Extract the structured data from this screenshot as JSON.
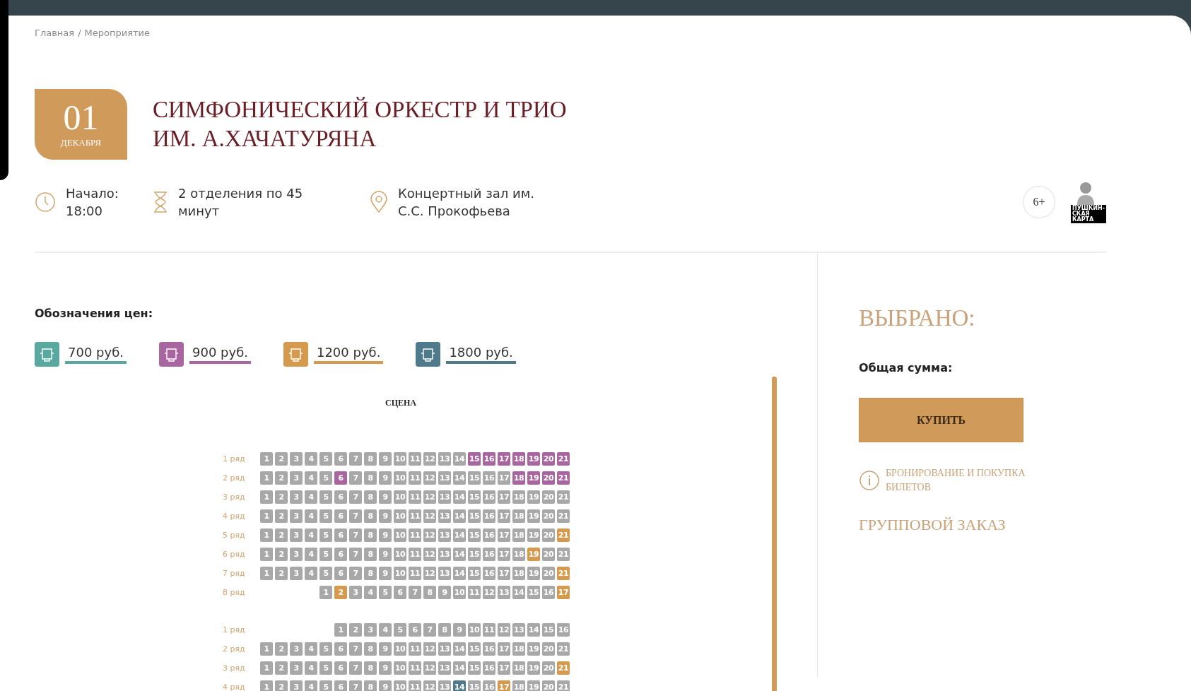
{
  "breadcrumb": [
    "Главная",
    "Мероприятие"
  ],
  "breadcrumb_separator": "/",
  "event": {
    "day": "01",
    "month": "ДЕКАБРЯ",
    "title": [
      "СИМФОНИЧЕСКИЙ ОРКЕСТР И ТРИО",
      "ИМ. А.ХАЧАТУРЯНА"
    ]
  },
  "info": [
    {
      "kind": "clock",
      "lines": [
        "Начало:",
        "18:00"
      ]
    },
    {
      "kind": "hourglass",
      "lines": [
        "2 отделения по 45",
        "минут"
      ]
    },
    {
      "kind": "pin",
      "lines": [
        "Концертный зал им.",
        "С.С. Прокофьева"
      ]
    }
  ],
  "age": "6+",
  "card_logo": [
    "ПУШКИН-",
    "СКАЯ",
    "КАРТА"
  ],
  "legend": {
    "title": "Обозначения цен:",
    "items": [
      {
        "label": "700 руб.",
        "color": "#5aa9a0"
      },
      {
        "label": "900 руб.",
        "color": "#a9659f"
      },
      {
        "label": "1200 руб.",
        "color": "#d59a4e"
      },
      {
        "label": "1800 руб.",
        "color": "#4f7a8c"
      }
    ]
  },
  "stage": "СЦЕНА",
  "sections": [
    {
      "rows": [
        {
          "label": "1 ряд",
          "seats": [
            {
              "n": "1",
              "color": "#a8a8a8"
            },
            {
              "n": "2",
              "color": "#a8a8a8"
            },
            {
              "n": "3",
              "color": "#a8a8a8"
            },
            {
              "n": "4",
              "color": "#a8a8a8"
            },
            {
              "n": "5",
              "color": "#a8a8a8"
            },
            {
              "n": "6",
              "color": "#a8a8a8"
            },
            {
              "n": "7",
              "color": "#a8a8a8"
            },
            {
              "n": "8",
              "color": "#a8a8a8"
            },
            {
              "n": "9",
              "color": "#a8a8a8"
            },
            {
              "n": "10",
              "color": "#a8a8a8"
            },
            {
              "n": "11",
              "color": "#a8a8a8"
            },
            {
              "n": "12",
              "color": "#a8a8a8"
            },
            {
              "n": "13",
              "color": "#a8a8a8"
            },
            {
              "n": "14",
              "color": "#a8a8a8"
            },
            {
              "n": "15",
              "color": "#a9659f"
            },
            {
              "n": "16",
              "color": "#a9659f"
            },
            {
              "n": "17",
              "color": "#a9659f"
            },
            {
              "n": "18",
              "color": "#a9659f"
            },
            {
              "n": "19",
              "color": "#a9659f"
            },
            {
              "n": "20",
              "color": "#a9659f"
            },
            {
              "n": "21",
              "color": "#a9659f"
            }
          ]
        },
        {
          "label": "2 ряд",
          "seats": [
            {
              "n": "1",
              "color": "#a8a8a8"
            },
            {
              "n": "2",
              "color": "#a8a8a8"
            },
            {
              "n": "3",
              "color": "#a8a8a8"
            },
            {
              "n": "4",
              "color": "#a8a8a8"
            },
            {
              "n": "5",
              "color": "#a8a8a8"
            },
            {
              "n": "6",
              "color": "#a9659f"
            },
            {
              "n": "7",
              "color": "#a8a8a8"
            },
            {
              "n": "8",
              "color": "#a8a8a8"
            },
            {
              "n": "9",
              "color": "#a8a8a8"
            },
            {
              "n": "10",
              "color": "#a8a8a8"
            },
            {
              "n": "11",
              "color": "#a8a8a8"
            },
            {
              "n": "12",
              "color": "#a8a8a8"
            },
            {
              "n": "13",
              "color": "#a8a8a8"
            },
            {
              "n": "14",
              "color": "#a8a8a8"
            },
            {
              "n": "15",
              "color": "#a8a8a8"
            },
            {
              "n": "16",
              "color": "#a8a8a8"
            },
            {
              "n": "17",
              "color": "#a8a8a8"
            },
            {
              "n": "18",
              "color": "#a9659f"
            },
            {
              "n": "19",
              "color": "#a9659f"
            },
            {
              "n": "20",
              "color": "#a9659f"
            },
            {
              "n": "21",
              "color": "#a9659f"
            }
          ]
        },
        {
          "label": "3 ряд",
          "seats": [
            {
              "n": "1",
              "color": "#a8a8a8"
            },
            {
              "n": "2",
              "color": "#a8a8a8"
            },
            {
              "n": "3",
              "color": "#a8a8a8"
            },
            {
              "n": "4",
              "color": "#a8a8a8"
            },
            {
              "n": "5",
              "color": "#a8a8a8"
            },
            {
              "n": "6",
              "color": "#a8a8a8"
            },
            {
              "n": "7",
              "color": "#a8a8a8"
            },
            {
              "n": "8",
              "color": "#a8a8a8"
            },
            {
              "n": "9",
              "color": "#a8a8a8"
            },
            {
              "n": "10",
              "color": "#a8a8a8"
            },
            {
              "n": "11",
              "color": "#a8a8a8"
            },
            {
              "n": "12",
              "color": "#a8a8a8"
            },
            {
              "n": "13",
              "color": "#a8a8a8"
            },
            {
              "n": "14",
              "color": "#a8a8a8"
            },
            {
              "n": "15",
              "color": "#a8a8a8"
            },
            {
              "n": "16",
              "color": "#a8a8a8"
            },
            {
              "n": "17",
              "color": "#a8a8a8"
            },
            {
              "n": "18",
              "color": "#a8a8a8"
            },
            {
              "n": "19",
              "color": "#a8a8a8"
            },
            {
              "n": "20",
              "color": "#a8a8a8"
            },
            {
              "n": "21",
              "color": "#a8a8a8"
            }
          ]
        },
        {
          "label": "4 ряд",
          "seats": [
            {
              "n": "1",
              "color": "#a8a8a8"
            },
            {
              "n": "2",
              "color": "#a8a8a8"
            },
            {
              "n": "3",
              "color": "#a8a8a8"
            },
            {
              "n": "4",
              "color": "#a8a8a8"
            },
            {
              "n": "5",
              "color": "#a8a8a8"
            },
            {
              "n": "6",
              "color": "#a8a8a8"
            },
            {
              "n": "7",
              "color": "#a8a8a8"
            },
            {
              "n": "8",
              "color": "#a8a8a8"
            },
            {
              "n": "9",
              "color": "#a8a8a8"
            },
            {
              "n": "10",
              "color": "#a8a8a8"
            },
            {
              "n": "11",
              "color": "#a8a8a8"
            },
            {
              "n": "12",
              "color": "#a8a8a8"
            },
            {
              "n": "13",
              "color": "#a8a8a8"
            },
            {
              "n": "14",
              "color": "#a8a8a8"
            },
            {
              "n": "15",
              "color": "#a8a8a8"
            },
            {
              "n": "16",
              "color": "#a8a8a8"
            },
            {
              "n": "17",
              "color": "#a8a8a8"
            },
            {
              "n": "18",
              "color": "#a8a8a8"
            },
            {
              "n": "19",
              "color": "#a8a8a8"
            },
            {
              "n": "20",
              "color": "#a8a8a8"
            },
            {
              "n": "21",
              "color": "#a8a8a8"
            }
          ]
        },
        {
          "label": "5 ряд",
          "seats": [
            {
              "n": "1",
              "color": "#a8a8a8"
            },
            {
              "n": "2",
              "color": "#a8a8a8"
            },
            {
              "n": "3",
              "color": "#a8a8a8"
            },
            {
              "n": "4",
              "color": "#a8a8a8"
            },
            {
              "n": "5",
              "color": "#a8a8a8"
            },
            {
              "n": "6",
              "color": "#a8a8a8"
            },
            {
              "n": "7",
              "color": "#a8a8a8"
            },
            {
              "n": "8",
              "color": "#a8a8a8"
            },
            {
              "n": "9",
              "color": "#a8a8a8"
            },
            {
              "n": "10",
              "color": "#a8a8a8"
            },
            {
              "n": "11",
              "color": "#a8a8a8"
            },
            {
              "n": "12",
              "color": "#a8a8a8"
            },
            {
              "n": "13",
              "color": "#a8a8a8"
            },
            {
              "n": "14",
              "color": "#a8a8a8"
            },
            {
              "n": "15",
              "color": "#a8a8a8"
            },
            {
              "n": "16",
              "color": "#a8a8a8"
            },
            {
              "n": "17",
              "color": "#a8a8a8"
            },
            {
              "n": "18",
              "color": "#a8a8a8"
            },
            {
              "n": "19",
              "color": "#a8a8a8"
            },
            {
              "n": "20",
              "color": "#a8a8a8"
            },
            {
              "n": "21",
              "color": "#d59a4e"
            }
          ]
        },
        {
          "label": "6 ряд",
          "seats": [
            {
              "n": "1",
              "color": "#a8a8a8"
            },
            {
              "n": "2",
              "color": "#a8a8a8"
            },
            {
              "n": "3",
              "color": "#a8a8a8"
            },
            {
              "n": "4",
              "color": "#a8a8a8"
            },
            {
              "n": "5",
              "color": "#a8a8a8"
            },
            {
              "n": "6",
              "color": "#a8a8a8"
            },
            {
              "n": "7",
              "color": "#a8a8a8"
            },
            {
              "n": "8",
              "color": "#a8a8a8"
            },
            {
              "n": "9",
              "color": "#a8a8a8"
            },
            {
              "n": "10",
              "color": "#a8a8a8"
            },
            {
              "n": "11",
              "color": "#a8a8a8"
            },
            {
              "n": "12",
              "color": "#a8a8a8"
            },
            {
              "n": "13",
              "color": "#a8a8a8"
            },
            {
              "n": "14",
              "color": "#a8a8a8"
            },
            {
              "n": "15",
              "color": "#a8a8a8"
            },
            {
              "n": "16",
              "color": "#a8a8a8"
            },
            {
              "n": "17",
              "color": "#a8a8a8"
            },
            {
              "n": "18",
              "color": "#a8a8a8"
            },
            {
              "n": "19",
              "color": "#d59a4e"
            },
            {
              "n": "20",
              "color": "#a8a8a8"
            },
            {
              "n": "21",
              "color": "#a8a8a8"
            }
          ]
        },
        {
          "label": "7 ряд",
          "seats": [
            {
              "n": "1",
              "color": "#a8a8a8"
            },
            {
              "n": "2",
              "color": "#a8a8a8"
            },
            {
              "n": "3",
              "color": "#a8a8a8"
            },
            {
              "n": "4",
              "color": "#a8a8a8"
            },
            {
              "n": "5",
              "color": "#a8a8a8"
            },
            {
              "n": "6",
              "color": "#a8a8a8"
            },
            {
              "n": "7",
              "color": "#a8a8a8"
            },
            {
              "n": "8",
              "color": "#a8a8a8"
            },
            {
              "n": "9",
              "color": "#a8a8a8"
            },
            {
              "n": "10",
              "color": "#a8a8a8"
            },
            {
              "n": "11",
              "color": "#a8a8a8"
            },
            {
              "n": "12",
              "color": "#a8a8a8"
            },
            {
              "n": "13",
              "color": "#a8a8a8"
            },
            {
              "n": "14",
              "color": "#a8a8a8"
            },
            {
              "n": "15",
              "color": "#a8a8a8"
            },
            {
              "n": "16",
              "color": "#a8a8a8"
            },
            {
              "n": "17",
              "color": "#a8a8a8"
            },
            {
              "n": "18",
              "color": "#a8a8a8"
            },
            {
              "n": "19",
              "color": "#a8a8a8"
            },
            {
              "n": "20",
              "color": "#a8a8a8"
            },
            {
              "n": "21",
              "color": "#d59a4e"
            }
          ]
        },
        {
          "label": "8 ряд",
          "seats": [
            {
              "n": "1",
              "color": "#a8a8a8"
            },
            {
              "n": "2",
              "color": "#d59a4e"
            },
            {
              "n": "3",
              "color": "#a8a8a8"
            },
            {
              "n": "4",
              "color": "#a8a8a8"
            },
            {
              "n": "5",
              "color": "#a8a8a8"
            },
            {
              "n": "6",
              "color": "#a8a8a8"
            },
            {
              "n": "7",
              "color": "#a8a8a8"
            },
            {
              "n": "8",
              "color": "#a8a8a8"
            },
            {
              "n": "9",
              "color": "#a8a8a8"
            },
            {
              "n": "10",
              "color": "#a8a8a8"
            },
            {
              "n": "11",
              "color": "#a8a8a8"
            },
            {
              "n": "12",
              "color": "#a8a8a8"
            },
            {
              "n": "13",
              "color": "#a8a8a8"
            },
            {
              "n": "14",
              "color": "#a8a8a8"
            },
            {
              "n": "15",
              "color": "#a8a8a8"
            },
            {
              "n": "16",
              "color": "#a8a8a8"
            },
            {
              "n": "17",
              "color": "#d59a4e"
            }
          ]
        }
      ]
    },
    {
      "rows": [
        {
          "label": "1 ряд",
          "seats": [
            {
              "n": "1",
              "color": "#a8a8a8"
            },
            {
              "n": "2",
              "color": "#a8a8a8"
            },
            {
              "n": "3",
              "color": "#a8a8a8"
            },
            {
              "n": "4",
              "color": "#a8a8a8"
            },
            {
              "n": "5",
              "color": "#a8a8a8"
            },
            {
              "n": "6",
              "color": "#a8a8a8"
            },
            {
              "n": "7",
              "color": "#a8a8a8"
            },
            {
              "n": "8",
              "color": "#a8a8a8"
            },
            {
              "n": "9",
              "color": "#a8a8a8"
            },
            {
              "n": "10",
              "color": "#a8a8a8"
            },
            {
              "n": "11",
              "color": "#a8a8a8"
            },
            {
              "n": "12",
              "color": "#a8a8a8"
            },
            {
              "n": "13",
              "color": "#a8a8a8"
            },
            {
              "n": "14",
              "color": "#a8a8a8"
            },
            {
              "n": "15",
              "color": "#a8a8a8"
            },
            {
              "n": "16",
              "color": "#a8a8a8"
            }
          ]
        },
        {
          "label": "2 ряд",
          "seats": [
            {
              "n": "1",
              "color": "#a8a8a8"
            },
            {
              "n": "2",
              "color": "#a8a8a8"
            },
            {
              "n": "3",
              "color": "#a8a8a8"
            },
            {
              "n": "4",
              "color": "#a8a8a8"
            },
            {
              "n": "5",
              "color": "#a8a8a8"
            },
            {
              "n": "6",
              "color": "#a8a8a8"
            },
            {
              "n": "7",
              "color": "#a8a8a8"
            },
            {
              "n": "8",
              "color": "#a8a8a8"
            },
            {
              "n": "9",
              "color": "#a8a8a8"
            },
            {
              "n": "10",
              "color": "#a8a8a8"
            },
            {
              "n": "11",
              "color": "#a8a8a8"
            },
            {
              "n": "12",
              "color": "#a8a8a8"
            },
            {
              "n": "13",
              "color": "#a8a8a8"
            },
            {
              "n": "14",
              "color": "#a8a8a8"
            },
            {
              "n": "15",
              "color": "#a8a8a8"
            },
            {
              "n": "16",
              "color": "#a8a8a8"
            },
            {
              "n": "17",
              "color": "#a8a8a8"
            },
            {
              "n": "18",
              "color": "#a8a8a8"
            },
            {
              "n": "19",
              "color": "#a8a8a8"
            },
            {
              "n": "20",
              "color": "#a8a8a8"
            },
            {
              "n": "21",
              "color": "#a8a8a8"
            }
          ]
        },
        {
          "label": "3 ряд",
          "seats": [
            {
              "n": "1",
              "color": "#a8a8a8"
            },
            {
              "n": "2",
              "color": "#a8a8a8"
            },
            {
              "n": "3",
              "color": "#a8a8a8"
            },
            {
              "n": "4",
              "color": "#a8a8a8"
            },
            {
              "n": "5",
              "color": "#a8a8a8"
            },
            {
              "n": "6",
              "color": "#a8a8a8"
            },
            {
              "n": "7",
              "color": "#a8a8a8"
            },
            {
              "n": "8",
              "color": "#a8a8a8"
            },
            {
              "n": "9",
              "color": "#a8a8a8"
            },
            {
              "n": "10",
              "color": "#a8a8a8"
            },
            {
              "n": "11",
              "color": "#a8a8a8"
            },
            {
              "n": "12",
              "color": "#a8a8a8"
            },
            {
              "n": "13",
              "color": "#a8a8a8"
            },
            {
              "n": "14",
              "color": "#a8a8a8"
            },
            {
              "n": "15",
              "color": "#a8a8a8"
            },
            {
              "n": "16",
              "color": "#a8a8a8"
            },
            {
              "n": "17",
              "color": "#a8a8a8"
            },
            {
              "n": "18",
              "color": "#a8a8a8"
            },
            {
              "n": "19",
              "color": "#a8a8a8"
            },
            {
              "n": "20",
              "color": "#a8a8a8"
            },
            {
              "n": "21",
              "color": "#d59a4e"
            }
          ]
        },
        {
          "label": "4 ряд",
          "seats": [
            {
              "n": "1",
              "color": "#a8a8a8"
            },
            {
              "n": "2",
              "color": "#a8a8a8"
            },
            {
              "n": "3",
              "color": "#a8a8a8"
            },
            {
              "n": "4",
              "color": "#a8a8a8"
            },
            {
              "n": "5",
              "color": "#a8a8a8"
            },
            {
              "n": "6",
              "color": "#a8a8a8"
            },
            {
              "n": "7",
              "color": "#a8a8a8"
            },
            {
              "n": "8",
              "color": "#a8a8a8"
            },
            {
              "n": "9",
              "color": "#a8a8a8"
            },
            {
              "n": "10",
              "color": "#a8a8a8"
            },
            {
              "n": "11",
              "color": "#a8a8a8"
            },
            {
              "n": "12",
              "color": "#a8a8a8"
            },
            {
              "n": "13",
              "color": "#a8a8a8"
            },
            {
              "n": "14",
              "color": "#4f7a8c"
            },
            {
              "n": "15",
              "color": "#a8a8a8"
            },
            {
              "n": "16",
              "color": "#a8a8a8"
            },
            {
              "n": "17",
              "color": "#d59a4e"
            },
            {
              "n": "18",
              "color": "#a8a8a8"
            },
            {
              "n": "19",
              "color": "#a8a8a8"
            },
            {
              "n": "20",
              "color": "#a8a8a8"
            },
            {
              "n": "21",
              "color": "#a8a8a8"
            }
          ]
        }
      ]
    }
  ],
  "summary": {
    "title": "ВЫБРАНО:",
    "total_label": "Общая сумма:",
    "buy": "КУПИТЬ",
    "info_link": [
      "БРОНИРОВАНИЕ И ПОКУПКА",
      "БИЛЕТОВ"
    ],
    "group": "ГРУППОВОЙ ЗАКАЗ"
  }
}
